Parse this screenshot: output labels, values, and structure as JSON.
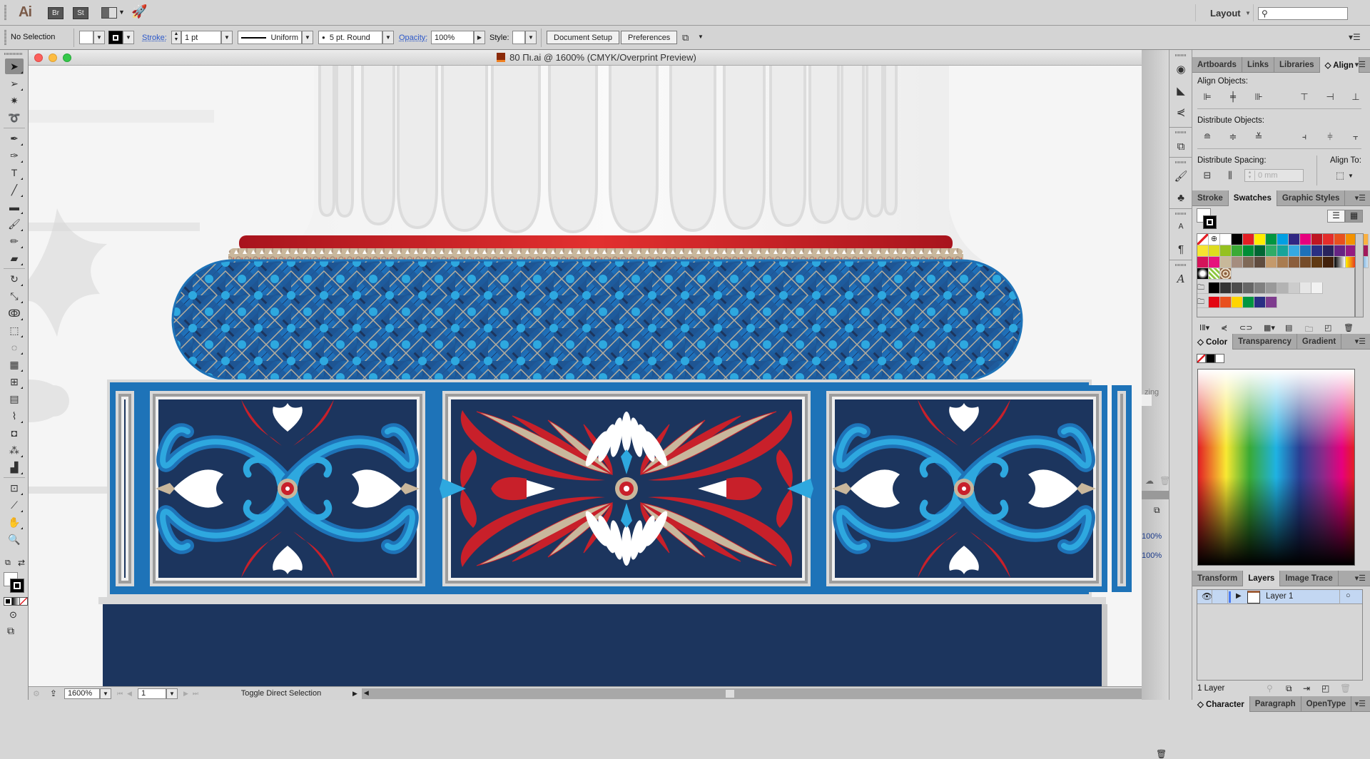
{
  "appbar": {
    "logo": "Ai",
    "bridge": "Br",
    "stock": "St",
    "workspace": "Layout",
    "search_placeholder": ""
  },
  "control": {
    "selection": "No Selection",
    "stroke_label": "Stroke:",
    "stroke_weight": "1 pt",
    "profile": "Uniform",
    "brush": "5 pt. Round",
    "opacity_label": "Opacity:",
    "opacity": "100%",
    "style_label": "Style:",
    "document_setup": "Document Setup",
    "preferences": "Preferences"
  },
  "document": {
    "title": "80 Πι.ai @ 1600% (CMYK/Overprint Preview)",
    "zoom": "1600%",
    "artboard": "1",
    "status": "Toggle Direct Selection"
  },
  "tools": [
    {
      "name": "selection-tool",
      "glyph": "➤"
    },
    {
      "name": "direct-selection-tool",
      "glyph": "➢"
    },
    {
      "name": "magic-wand-tool",
      "glyph": "✷"
    },
    {
      "name": "lasso-tool",
      "glyph": "➰"
    },
    {
      "name": "pen-tool",
      "glyph": "✒"
    },
    {
      "name": "curvature-tool",
      "glyph": "✑"
    },
    {
      "name": "type-tool",
      "glyph": "T"
    },
    {
      "name": "line-tool",
      "glyph": "╱"
    },
    {
      "name": "rectangle-tool",
      "glyph": "▬"
    },
    {
      "name": "paintbrush-tool",
      "glyph": "🖌"
    },
    {
      "name": "pencil-tool",
      "glyph": "✏"
    },
    {
      "name": "eraser-tool",
      "glyph": "▰"
    },
    {
      "name": "rotate-tool",
      "glyph": "↻"
    },
    {
      "name": "scale-tool",
      "glyph": "⤡"
    },
    {
      "name": "warp-tool",
      "glyph": "ↂ"
    },
    {
      "name": "free-transform-tool",
      "glyph": "⬚"
    },
    {
      "name": "shape-builder-tool",
      "glyph": "◌"
    },
    {
      "name": "perspective-grid-tool",
      "glyph": "▦"
    },
    {
      "name": "mesh-tool",
      "glyph": "⊞"
    },
    {
      "name": "gradient-tool",
      "glyph": "▤"
    },
    {
      "name": "eyedropper-tool",
      "glyph": "⌇"
    },
    {
      "name": "blend-tool",
      "glyph": "◘"
    },
    {
      "name": "symbol-sprayer-tool",
      "glyph": "⁂"
    },
    {
      "name": "column-graph-tool",
      "glyph": "▟"
    },
    {
      "name": "artboard-tool",
      "glyph": "⊡"
    },
    {
      "name": "slice-tool",
      "glyph": "⟋"
    },
    {
      "name": "hand-tool",
      "glyph": "✋"
    },
    {
      "name": "zoom-tool",
      "glyph": "🔍"
    }
  ],
  "panels": {
    "align": {
      "tabs": [
        "Artboards",
        "Links",
        "Libraries",
        "◇ Align"
      ],
      "align_objects": "Align Objects:",
      "distribute_objects": "Distribute Objects:",
      "distribute_spacing": "Distribute Spacing:",
      "align_to": "Align To:",
      "spacing_value": "0 mm"
    },
    "swatches": {
      "tabs": [
        "Stroke",
        "Swatches",
        "Graphic Styles"
      ],
      "row1": [
        "none",
        "registration",
        "#ffffff",
        "#000000",
        "#e31e24",
        "#ffed00",
        "#009640",
        "#009fe3",
        "#312783",
        "#e6007e",
        "#be1622",
        "#e42d2b",
        "#e8501e",
        "#f39200",
        "#fbb040"
      ],
      "row2": [
        "#f6e531",
        "#dedc1f",
        "#95c11f",
        "#3aaa35",
        "#008d36",
        "#006633",
        "#2fac66",
        "#16a49a",
        "#36a9e1",
        "#1d71b8",
        "#2a2f83",
        "#29235c",
        "#662483",
        "#951b81",
        "#a2195b"
      ],
      "row3": [
        "#d4145a",
        "#e6127d",
        "#c8b89a",
        "#a58d7f",
        "#7f6957",
        "#604c3f",
        "#c49a6c",
        "#a97c50",
        "#8b5e3c",
        "#754c29",
        "#603913",
        "#42210b",
        "gradient-bw",
        "gradient-orange",
        "gradient-blue"
      ],
      "row4": [
        "pattern-dots",
        "pattern-leaf",
        "pattern-brown"
      ],
      "gray_group": [
        "#000000",
        "#333333",
        "#4d4d4d",
        "#666666",
        "#808080",
        "#999999",
        "#b3b3b3",
        "#cccccc",
        "#e6e6e6",
        "#f2f2f2"
      ],
      "color_group": [
        "#e30613",
        "#e8501e",
        "#ffd500",
        "#009640",
        "#2a2f83",
        "#7e3c8e"
      ]
    },
    "color": {
      "tabs": [
        "◇ Color",
        "Transparency",
        "Gradient"
      ]
    },
    "layers": {
      "tabs": [
        "Transform",
        "Layers",
        "Image Trace"
      ],
      "items": [
        {
          "name": "Layer 1"
        }
      ],
      "count": "1 Layer"
    },
    "character": {
      "tabs": [
        "◇ Character",
        "Paragraph",
        "OpenType"
      ]
    },
    "hidden_panel": {
      "partial_label": "zing",
      "opacity_a": "100%",
      "opacity_b": "100%"
    }
  },
  "artwork": {
    "colors": {
      "navy": "#1c355e",
      "blue": "#1e73b8",
      "light_blue": "#2ea8df",
      "red": "#c8202a",
      "tan": "#c9b79c",
      "white": "#ffffff",
      "gray": "#c8c8c8"
    }
  }
}
